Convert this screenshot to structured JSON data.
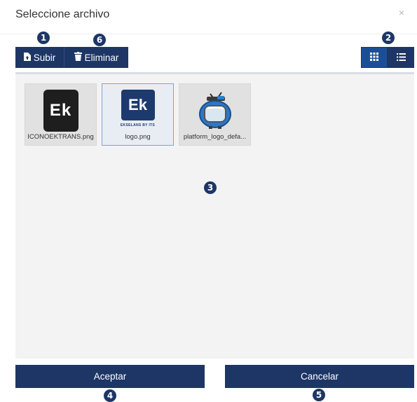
{
  "dialog": {
    "title": "Seleccione archivo",
    "close_label": "×"
  },
  "toolbar": {
    "upload_label": "Subir",
    "delete_label": "Eliminar",
    "grid_view_icon": "grid-icon",
    "list_view_icon": "list-icon",
    "active_view": "grid"
  },
  "files": [
    {
      "name": "ICONOEKTRANS.png",
      "thumb_text": "Ek",
      "selected": false
    },
    {
      "name": "logo.png",
      "thumb_text": "Ek",
      "thumb_subtext": "EKSELANS BY ITS",
      "selected": true
    },
    {
      "name": "platform_logo_defa...",
      "selected": false
    }
  ],
  "footer": {
    "accept_label": "Aceptar",
    "cancel_label": "Cancelar"
  },
  "badges": {
    "b1": "1",
    "b2": "2",
    "b3": "3",
    "b4": "4",
    "b5": "5",
    "b6": "6"
  },
  "colors": {
    "primary": "#1d3666",
    "active": "#1a4f98",
    "panel_bg": "#f3f3f3"
  }
}
